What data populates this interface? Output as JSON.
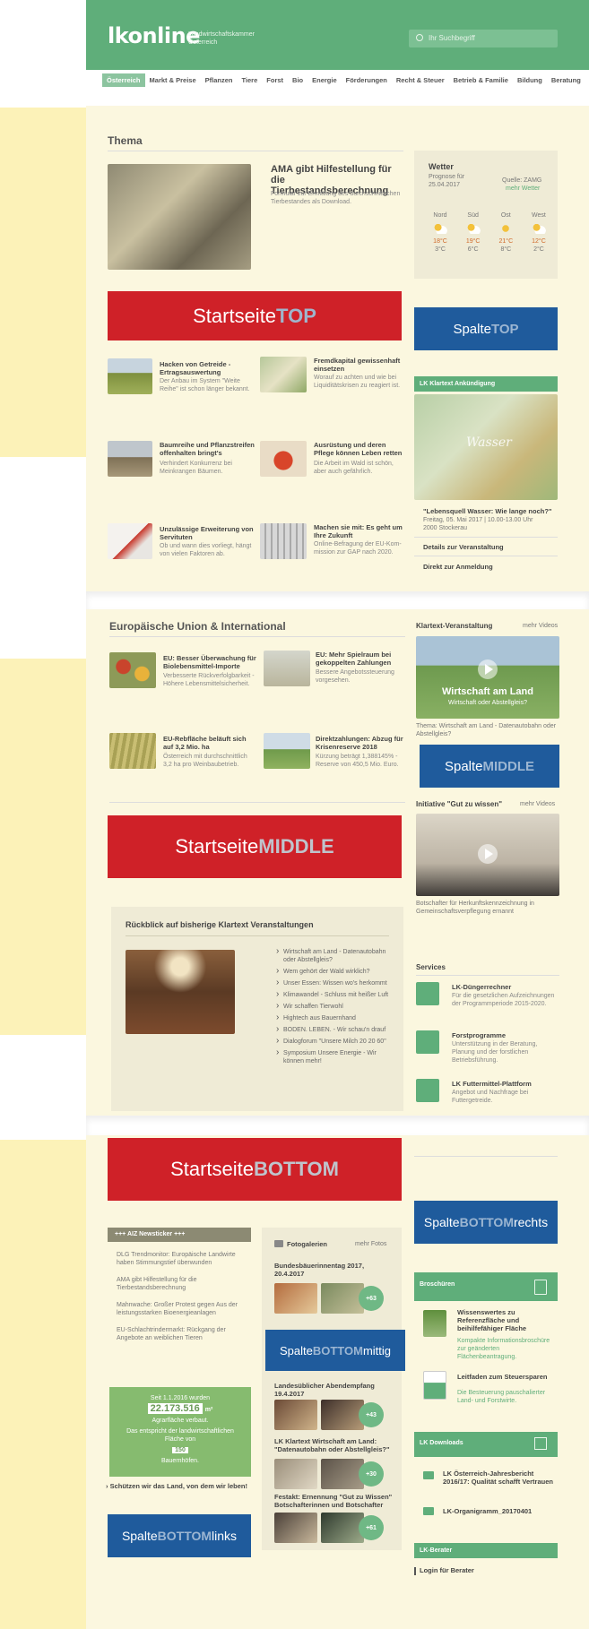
{
  "header": {
    "logo": "lkonline",
    "logo_sub_1": "Landwirtschaftskammer",
    "logo_sub_2": "Österreich",
    "search_placeholder": "Ihr Suchbegriff"
  },
  "nav": {
    "items": [
      "Österreich",
      "Markt & Preise",
      "Pflanzen",
      "Tiere",
      "Forst",
      "Bio",
      "Energie",
      "Förderungen",
      "Recht & Steuer",
      "Betrieb & Familie",
      "Bildung",
      "Beratung"
    ]
  },
  "thema": {
    "title": "Thema",
    "lead_title": "AMA gibt Hilfestellung für die Tierbestandsberechnung",
    "lead_body": "Formular zur Ermittlung des durchschnittlichen Tierbestandes als Download.",
    "articles": [
      {
        "title": "Hacken von Getreide - Ertragsauswertung",
        "body": "Der Anbau im System \"Weite Reihe\" ist schon länger bekannt."
      },
      {
        "title": "Fremdkapital gewissenhaft einsetzen",
        "body": "Worauf zu achten und wie bei Liquiditätskrisen zu reagiert ist."
      },
      {
        "title": "Baumreihe und Pflanzstreifen offenhalten bringt's",
        "body": "Verhindert Konkurrenz bei Meinkrangen Bäumen."
      },
      {
        "title": "Ausrüstung und deren Pflege können Leben retten",
        "body": "Die Arbeit im Wald ist schön, aber auch gefährlich."
      },
      {
        "title": "Unzulässige Erweiterung von Servituten",
        "body": "Ob und wann dies vorliegt, hängt von vielen Faktoren ab."
      },
      {
        "title": "Machen sie mit: Es geht um Ihre Zukunft",
        "body": "Online-Befragung der EU-Kom-mission zur GAP nach 2020."
      }
    ]
  },
  "weather": {
    "title": "Wetter",
    "forecast": "Prognose für",
    "date": "25.04.2017",
    "source": "Quelle: ZAMG",
    "more": "mehr Wetter",
    "regions": [
      "Nord",
      "Süd",
      "Ost",
      "West"
    ],
    "highs": [
      "18°C",
      "19°C",
      "21°C",
      "12°C"
    ],
    "lows": [
      "3°C",
      "6°C",
      "8°C",
      "2°C"
    ]
  },
  "klartext": {
    "bar": "LK Klartext Ankündigung",
    "event_title": "\"Lebensquell Wasser: Wie lange noch?\"",
    "event_date": "Freitag, 05. Mai 2017 | 10.00-13.00 Uhr",
    "event_place": "2000 Stockerau",
    "link1": "Details zur Veranstaltung",
    "link2": "Direkt zur Anmeldung"
  },
  "labels": {
    "start_top_a": "Startseite ",
    "start_top_b": "TOP",
    "spalte_top_a": "Spalte ",
    "spalte_top_b": "TOP",
    "start_mid_a": "Startseite ",
    "start_mid_b": "MIDDLE",
    "spalte_mid_a": "Spalte ",
    "spalte_mid_b": "MIDDLE",
    "start_bot_a": "Startseite ",
    "start_bot_b": "BOTTOM",
    "spalte_bot_r_a": "Spalte ",
    "spalte_bot_r_b": "BOTTOM",
    "spalte_bot_r_c": " rechts",
    "spalte_bot_m_a": "Spalte ",
    "spalte_bot_m_b": "BOTTOM",
    "spalte_bot_m_c": " mittig",
    "spalte_bot_l_a": "Spalte ",
    "spalte_bot_l_b": "BOTTOM",
    "spalte_bot_l_c": " links"
  },
  "eu": {
    "title": "Europäische Union & International",
    "articles": [
      {
        "title": "EU: Besser Überwachung für Biolebensmittel-Importe",
        "body": "Verbesserte Rückverfolgbarkeit - Höhere Lebensmittelsicherheit."
      },
      {
        "title": "EU: Mehr Spielraum bei gekoppelten Zahlungen",
        "body": "Bessere Angebotssteuerung vorgesehen."
      },
      {
        "title": "EU-Rebfläche beläuft sich auf 3,2 Mio. ha",
        "body": "Österreich mit durchschnittlich 3,2 ha pro Weinbaubetrieb."
      },
      {
        "title": "Direktzahlungen: Abzug für Krisenreserve 2018",
        "body": "Kürzung beträgt 1,388145% - Reserve von 450,5 Mio. Euro."
      }
    ]
  },
  "klartext_video": {
    "title": "Klartext-Veranstaltung",
    "more": "mehr Videos",
    "video_text_1": "Wirtschaft am Land",
    "video_text_2": "Wirtschaft oder Abstellgleis?",
    "caption": "Thema: Wirtschaft am Land - Datenautobahn oder Abstellgleis?"
  },
  "gut_video": {
    "title": "Initiative \"Gut zu wissen\"",
    "more": "mehr Videos",
    "caption": "Botschafter für Herkunftskennzeichnung in Gemeinschaftsverpflegung ernannt"
  },
  "rueckblick": {
    "title": "Rückblick auf bisherige Klartext Veranstaltungen",
    "items": [
      "Wirtschaft am Land - Datenautobahn oder Abstellgleis?",
      "Wem gehört der Wald wirklich?",
      "Unser Essen: Wissen wo's herkommt",
      "Klimawandel - Schluss mit heißer Luft",
      "Wir schaffen Tierwohl",
      "Hightech aus Bauernhand",
      "BODEN. LEBEN. - Wir schau'n drauf",
      "Dialogforum \"Unsere Milch 20 20 60\"",
      "Symposium Unsere Energie - Wir können mehr!"
    ]
  },
  "services": {
    "title": "Services",
    "items": [
      {
        "title": "LK-Düngerrechner",
        "body": "Für die gesetzlichen Aufzeichnungen der Programmperiode 2015-2020."
      },
      {
        "title": "Forstprogramme",
        "body": "Unterstützung in der Beratung, Planung und der forstlichen Betriebsführung."
      },
      {
        "title": "LK Futtermittel-Plattform",
        "body": "Angebot und Nachfrage bei Futtergetreide."
      }
    ]
  },
  "newsticker": {
    "bar": "+++ AIZ Newsticker +++",
    "items": [
      "DLG Trendmonitor: Europäische Landwirte haben Stimmungstief überwunden",
      "AMA gibt Hilfestellung für die Tierbestandsberechnung",
      "Mahnwache: Großer Protest gegen Aus der leistungsstarken Bioenergieanlagen",
      "EU-Schlachtrindermarkt: Rückgang der Angebote an weiblichen Tieren"
    ]
  },
  "counter": {
    "line1": "Seit 1.1.2016 wurden",
    "number": "22.173.516",
    "unit": "m²",
    "line2": "Agrarfläche verbaut.",
    "line3": "Das entspricht der landwirtschaftlichen Fläche von",
    "count": "150",
    "line4": "Bauernhöfen.",
    "link": "Schützen wir das Land, von dem wir leben!"
  },
  "fotos": {
    "title": "Fotogalerien",
    "more": "mehr Fotos",
    "items": [
      {
        "title": "Bundesbäuerinnentag 2017, 20.4.2017",
        "count": "+63"
      },
      {
        "title": "Landesüblicher Abendempfang 19.4.2017",
        "count": "+43"
      },
      {
        "title": "LK Klartext Wirtschaft am Land: \"Datenautobahn oder Abstellgleis?\"",
        "count": "+30"
      },
      {
        "title": "Festakt: Ernennung \"Gut zu Wissen\" Botschafterinnen und Botschafter",
        "count": "+61"
      }
    ]
  },
  "brosch": {
    "bar": "Broschüren",
    "items": [
      {
        "title": "Wissenswertes zu Referenzfläche und beihilfefähiger Fläche",
        "body": "Kompakte Informationsbroschüre zur geänderten Flächenbeantragung."
      },
      {
        "title": "Leitfaden zum Steuersparen",
        "body": "Die Besteuerung pauschalierter Land- und Forstwirte."
      }
    ]
  },
  "downloads": {
    "bar": "LK Downloads",
    "items": [
      "LK Österreich-Jahresbericht 2016/17: Qualität schafft Vertrauen",
      "LK-Organigramm_20170401"
    ]
  },
  "berater": {
    "bar": "LK-Berater",
    "link": "Login für Berater"
  },
  "colors": {
    "green": "#5fae7a",
    "red": "#cf2128",
    "blue": "#1f5b9c",
    "cream": "#fbf7df",
    "yellow": "#fcf2b8"
  }
}
